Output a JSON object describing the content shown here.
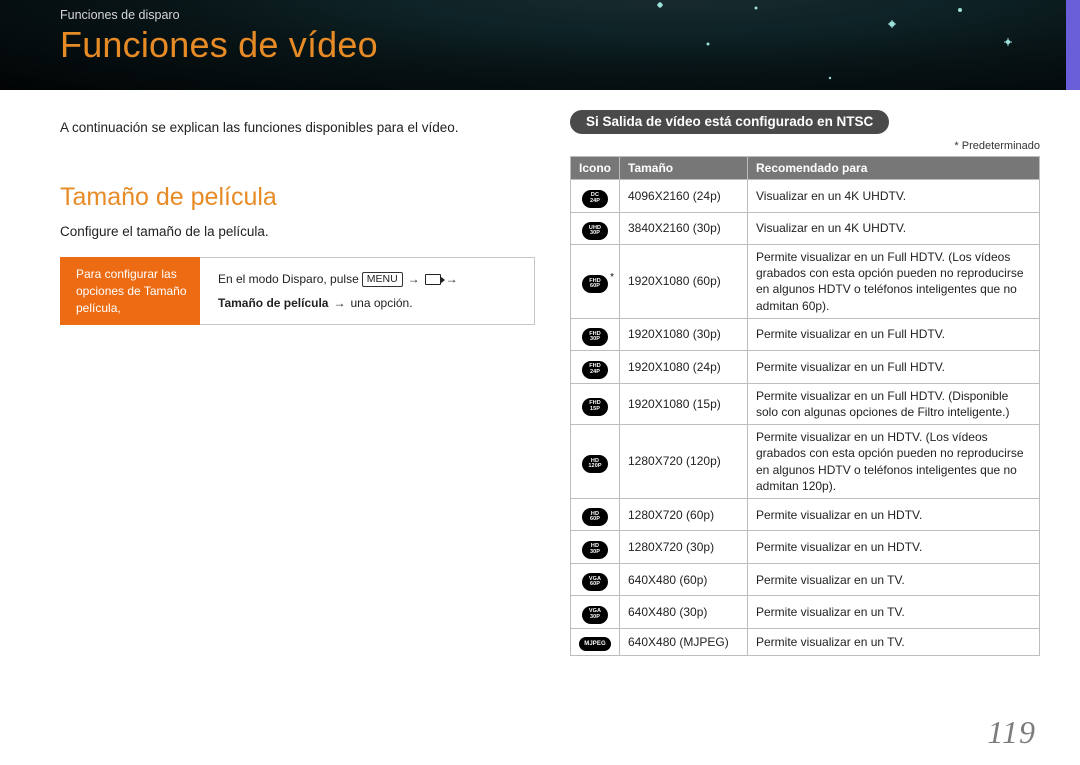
{
  "breadcrumb": "Funciones de disparo",
  "page_title": "Funciones de vídeo",
  "intro": "A continuación se explican las funciones disponibles para el vídeo.",
  "section_heading": "Tamaño de película",
  "section_sub": "Configure el tamaño de la película.",
  "instruction": {
    "left": "Para configurar las opciones de Tamaño película,",
    "r_pre": "En el modo Disparo, pulse ",
    "r_menu": "MENU",
    "r_arrow": "→",
    "r_bold1": "Tamaño de película",
    "r_bold2": "una opción."
  },
  "pill": "Si Salida de vídeo está configurado en NTSC",
  "note": "* Predeterminado",
  "table": {
    "headers": {
      "icon": "Icono",
      "size": "Tamaño",
      "rec": "Recomendado para"
    },
    "rows": [
      {
        "icon_lines": [
          "DC",
          "24P"
        ],
        "default": false,
        "size": "4096X2160 (24p)",
        "rec": "Visualizar en un 4K UHDTV."
      },
      {
        "icon_lines": [
          "UHD",
          "30P"
        ],
        "default": false,
        "size": "3840X2160 (30p)",
        "rec": "Visualizar en un 4K UHDTV."
      },
      {
        "icon_lines": [
          "FHD",
          "60P"
        ],
        "default": true,
        "size": "1920X1080 (60p)",
        "rec": "Permite visualizar en un Full HDTV. (Los vídeos grabados con esta opción pueden no reproducirse en algunos HDTV o teléfonos inteligentes que no admitan 60p)."
      },
      {
        "icon_lines": [
          "FHD",
          "30P"
        ],
        "default": false,
        "size": "1920X1080 (30p)",
        "rec": "Permite visualizar en un Full HDTV."
      },
      {
        "icon_lines": [
          "FHD",
          "24P"
        ],
        "default": false,
        "size": "1920X1080 (24p)",
        "rec": "Permite visualizar en un Full HDTV."
      },
      {
        "icon_lines": [
          "FHD",
          "15P"
        ],
        "default": false,
        "size": "1920X1080 (15p)",
        "rec": "Permite visualizar en un Full HDTV. (Disponible solo con algunas opciones de Filtro inteligente.)"
      },
      {
        "icon_lines": [
          "HD",
          "120P"
        ],
        "default": false,
        "size": "1280X720 (120p)",
        "rec": "Permite visualizar en un HDTV. (Los vídeos grabados con esta opción pueden no reproducirse en algunos HDTV o teléfonos inteligentes que no admitan 120p)."
      },
      {
        "icon_lines": [
          "HD",
          "60P"
        ],
        "default": false,
        "size": "1280X720 (60p)",
        "rec": "Permite visualizar en un HDTV."
      },
      {
        "icon_lines": [
          "HD",
          "30P"
        ],
        "default": false,
        "size": "1280X720 (30p)",
        "rec": "Permite visualizar en un HDTV."
      },
      {
        "icon_lines": [
          "VGA",
          "60P"
        ],
        "default": false,
        "size": "640X480 (60p)",
        "rec": "Permite visualizar en un TV."
      },
      {
        "icon_lines": [
          "VGA",
          "30P"
        ],
        "default": false,
        "size": "640X480 (30p)",
        "rec": "Permite visualizar en un TV."
      },
      {
        "icon_lines": [
          "MJPEG"
        ],
        "mjpeg": true,
        "default": false,
        "size": "640X480 (MJPEG)",
        "rec": "Permite visualizar en un TV."
      }
    ]
  },
  "page_number": "119"
}
